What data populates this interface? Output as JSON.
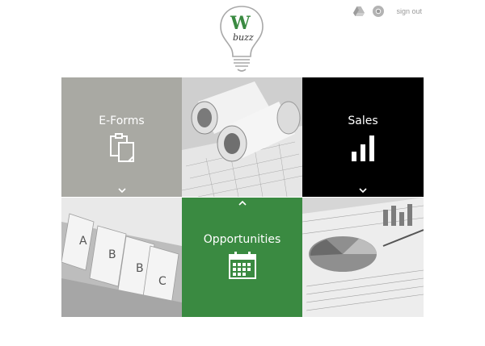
{
  "header": {
    "logo_letter": "W",
    "logo_word": "buzz",
    "icons": [
      "google-drive-icon",
      "chrome-icon"
    ],
    "signout_label": "sign out"
  },
  "tiles": [
    {
      "label": "E-Forms",
      "kind": "menu",
      "icon": "forms-clipboard-icon",
      "color": "#a9a9a3"
    },
    {
      "label": "",
      "kind": "photo",
      "icon": "blueprint-rolls-photo"
    },
    {
      "label": "Sales",
      "kind": "menu",
      "icon": "bar-chart-icon",
      "color": "#000000"
    },
    {
      "label": "",
      "kind": "photo",
      "icon": "index-cards-photo"
    },
    {
      "label": "Opportunities",
      "kind": "menu",
      "icon": "calendar-icon",
      "color": "#3a8a41"
    },
    {
      "label": "",
      "kind": "photo",
      "icon": "financial-report-photo"
    }
  ],
  "colors": {
    "brand_green": "#3a8a41",
    "grey_tile": "#a9a9a3",
    "black_tile": "#000000"
  }
}
